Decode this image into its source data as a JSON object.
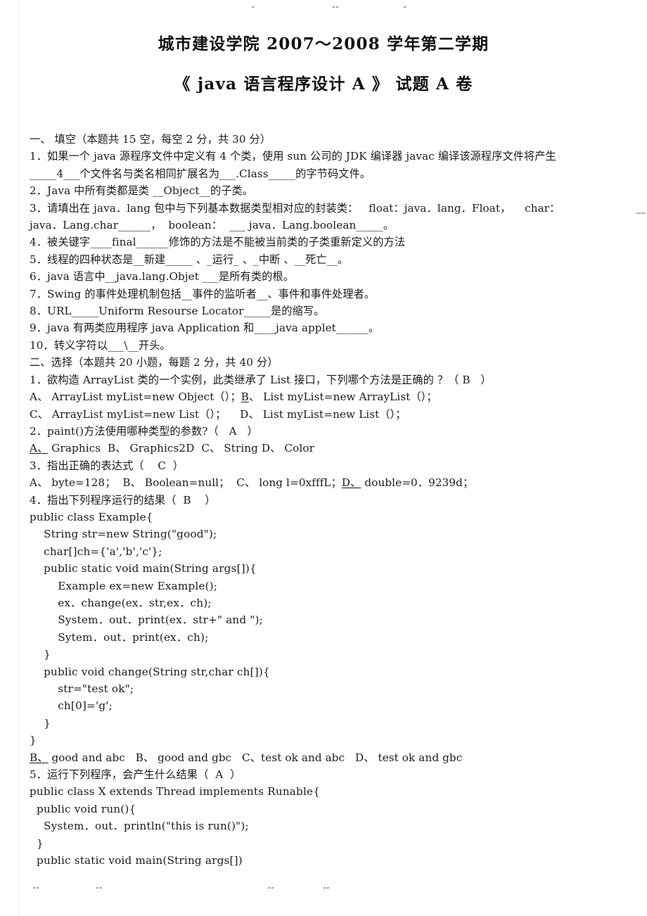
{
  "document": {
    "title": "城市建设学院  2007～2008 学年第二学期",
    "subtitle": "《 java 语言程序设计  A 》  试题 A 卷"
  },
  "scan_marks": {
    "top": [
      "ˮ",
      "ˮˮ",
      "ˮ"
    ],
    "bottom": [
      "ˮˮ",
      "ˮˮ",
      "ˮˮ",
      "ˮˮ"
    ]
  },
  "section_one": {
    "heading": "一、 填空（本题共 15 空，每空 2 分，共 30 分）",
    "lines": [
      "1．如果一个 java 源程序文件中定义有 4 个类，使用 sun 公司的 JDK 编译器 javac 编译该源程序文件将产生",
      "_____4___个文件名与类名相同扩展名为___.Class_____的字节码文件。",
      "2．Java 中所有类都是类 __Object__的子类。",
      "3．请填出在 java．lang 包中与下列基本数据类型相对应的封装类：   float：java．lang．Float，    char：",
      "java．Lang.char______，  boolean：  ___ java．Lang.boolean_____。",
      "4．被关键字____final______修饰的方法是不能被当前类的子类重新定义的方法",
      "5．线程的四种状态是__新建_____ 、_运行_ 、_中断 、__死亡__。",
      "6．java 语言中__java.lang.Objet ___是所有类的根。",
      "7．Swing 的事件处理机制包括__事件的监听者__、事件和事件处理者。",
      "8．URL_____Uniform Resourse Locator_____是的缩写。",
      "9．java 有两类应用程序 java Application 和____java applet______。",
      "10．转义字符以___\\__开头。"
    ]
  },
  "section_two": {
    "heading": "二、选择（本题共 20 小题，每题 2 分，共 40 分）",
    "q1": {
      "stem": "1．欲构造 ArrayList 类的一个实例，此类继承了 List 接口，下列哪个方法是正确的 ？（ B   ）",
      "options_line1_pre": "A、 ArrayList myList=new Object（）；",
      "options_line1_mark": "B",
      "options_line1_post": "、 List myList=new ArrayList（）；",
      "options_line2": "C、 ArrayList myList=new List（）；    D、 List myList=new List（）；"
    },
    "q2": {
      "stem": "2．paint()方法使用哪种类型的参数?（   A   ）",
      "options_mark": "A、",
      "options_post": " Graphics  B、 Graphics2D  C、 String D、 Color"
    },
    "q3": {
      "stem": "3．指出正确的表达式（    C  ）",
      "options_pre": "A、 byte=128；  B、 Boolean=null；  C、 long l=0xfffL；",
      "options_mark": "D、",
      "options_post": " double=0．9239d；"
    },
    "q4": {
      "stem": "4．指出下列程序运行的结果（  B    ）",
      "code": [
        "public class Example{",
        "    String str=new String(\"good\");",
        "    char[]ch={'a','b','c'};",
        "    public static void main(String args[]){",
        "        Example ex=new Example();",
        "        ex．change(ex．str,ex．ch);",
        "        System．out．print(ex．str+\" and \");",
        "        Sytem．out．print(ex．ch);",
        "    }",
        "    public void change(String str,char ch[]){",
        "        str=\"test ok\";",
        "        ch[0]='g';",
        "    }",
        "}"
      ],
      "options_mark": "B、",
      "options_post": " good and abc   B、 good and gbc   C、test ok and abc   D、 test ok and gbc"
    },
    "q5": {
      "stem": "5．运行下列程序，会产生什么结果（  A  ）",
      "code": [
        "public class X extends Thread implements Runable{",
        "  public void run(){",
        "    System．out．println(\"this is run()\");",
        "  }",
        "  public static void main(String args[])"
      ]
    }
  }
}
